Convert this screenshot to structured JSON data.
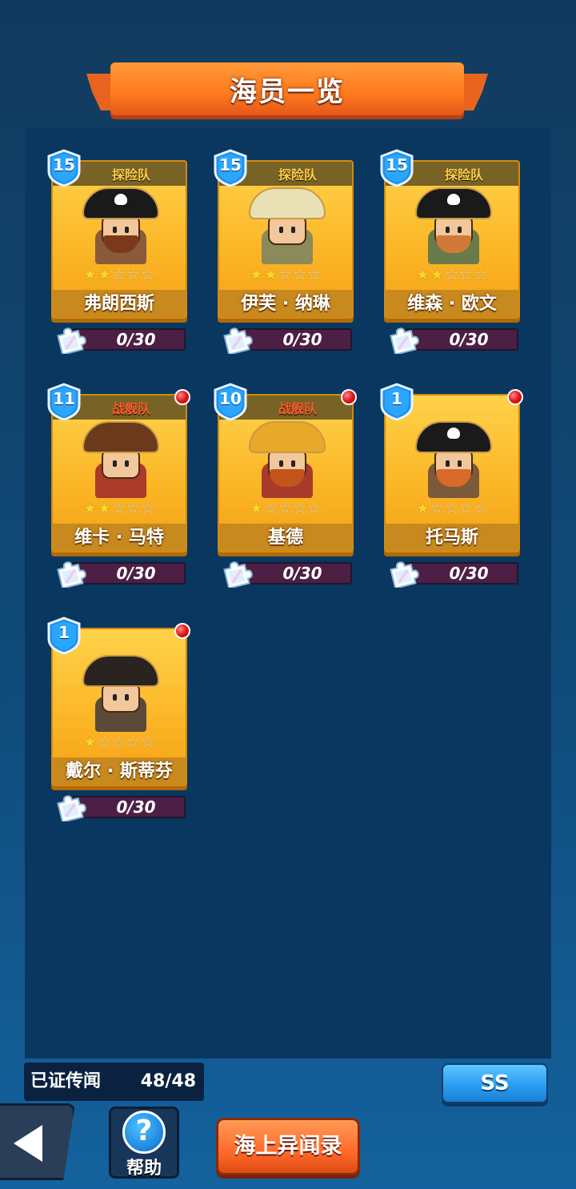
{
  "title": "海员一览",
  "crew": [
    {
      "name": "弗朗西斯",
      "team": "探险队",
      "team_type": "expedition",
      "level": "15",
      "stars": 2,
      "max_stars": 5,
      "shards": "0/30",
      "new": false,
      "hat": "pirate",
      "beard": true
    },
    {
      "name": "伊芙 · 纳琳",
      "team": "探险队",
      "team_type": "expedition",
      "level": "15",
      "stars": 2,
      "max_stars": 5,
      "shards": "0/30",
      "new": false,
      "hat": "helmet",
      "beard": false
    },
    {
      "name": "维森 · 欧文",
      "team": "探险队",
      "team_type": "expedition",
      "level": "15",
      "stars": 2,
      "max_stars": 5,
      "shards": "0/30",
      "new": false,
      "hat": "pirate",
      "beard": true
    },
    {
      "name": "维卡 · 马特",
      "team": "战舰队",
      "team_type": "warship",
      "level": "11",
      "stars": 2,
      "max_stars": 5,
      "shards": "0/30",
      "new": true,
      "hat": "headband",
      "beard": false
    },
    {
      "name": "基德",
      "team": "战舰队",
      "team_type": "warship",
      "level": "10",
      "stars": 1,
      "max_stars": 5,
      "shards": "0/30",
      "new": true,
      "hat": "crown",
      "beard": true
    },
    {
      "name": "托马斯",
      "team": "",
      "team_type": "none",
      "level": "1",
      "stars": 1,
      "max_stars": 5,
      "shards": "0/30",
      "new": true,
      "hat": "pirate",
      "beard": true
    },
    {
      "name": "戴尔 · 斯蒂芬",
      "team": "",
      "team_type": "none",
      "level": "1",
      "stars": 1,
      "max_stars": 5,
      "shards": "0/30",
      "new": true,
      "hat": "tricorn",
      "beard": false
    }
  ],
  "legend": {
    "label": "已证传闻",
    "count": "48/48"
  },
  "buttons": {
    "ss": "SS",
    "help": "帮助",
    "sea": "海上异闻录"
  },
  "icons": {
    "back": "back-arrow-icon",
    "help": "question-icon",
    "shard": "puzzle-piece-icon",
    "level": "shield-icon",
    "star": "star-icon",
    "new": "red-dot-notification"
  },
  "colors": {
    "card": "#fbb525",
    "expedition_team": "#ffcd4a",
    "warship_team": "#ff5a2a",
    "shard_bar": "#4d1f45",
    "ss_button": "#2b9ef2",
    "sea_button": "#ff6a2a"
  }
}
